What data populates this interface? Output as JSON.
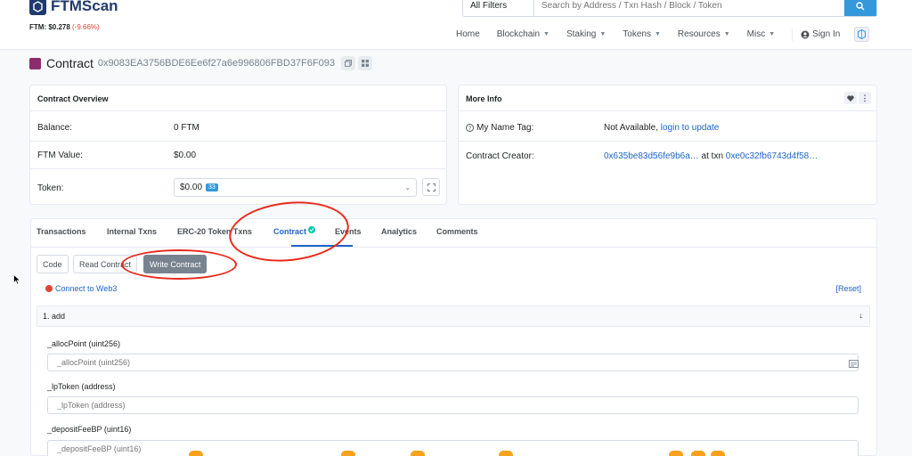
{
  "header": {
    "logo_text": "FTMScan",
    "price_label": "FTM: $0.278",
    "price_change": "(-9.66%)",
    "search_filter": "All Filters",
    "search_placeholder": "Search by Address / Txn Hash / Block / Token",
    "nav": [
      "Home",
      "Blockchain",
      "Staking",
      "Tokens",
      "Resources",
      "Misc",
      "Sign In"
    ]
  },
  "title": {
    "label": "Contract",
    "address": "0x9083EA3756BDE6Ee6f27a6e996806FBD37F6F093"
  },
  "overview": {
    "title": "Contract Overview",
    "balance_label": "Balance:",
    "balance_value": "0 FTM",
    "ftm_value_label": "FTM Value:",
    "ftm_value": "$0.00",
    "token_label": "Token:",
    "token_value": "$0.00",
    "token_count": "33"
  },
  "more_info": {
    "title": "More Info",
    "name_tag_label": "My Name Tag:",
    "name_tag_value": "Not Available,",
    "name_tag_link": "login to update",
    "creator_label": "Contract Creator:",
    "creator_address": "0x635be83d56fe9b6a…",
    "creator_at": "at txn",
    "creator_txn": "0xe0c32fb6743d4f58…"
  },
  "tabs": [
    "Transactions",
    "Internal Txns",
    "ERC-20 Token Txns",
    "Contract",
    "Events",
    "Analytics",
    "Comments"
  ],
  "sub_buttons": [
    "Code",
    "Read Contract",
    "Write Contract"
  ],
  "connect_label": "Connect to Web3",
  "reset_label": "[Reset]",
  "function": {
    "title": "1. add",
    "fields": [
      {
        "label": "_allocPoint (uint256)",
        "placeholder": "_allocPoint (uint256)"
      },
      {
        "label": "_lpToken (address)",
        "placeholder": "_lpToken (address)"
      },
      {
        "label": "_depositFeeBP (uint16)",
        "placeholder": "_depositFeeBP (uint16)"
      }
    ]
  },
  "colors": {
    "accent": "#1e64c8",
    "brand": "#1f3a6d",
    "negative": "#de4437",
    "annotation": "#e8291c"
  }
}
